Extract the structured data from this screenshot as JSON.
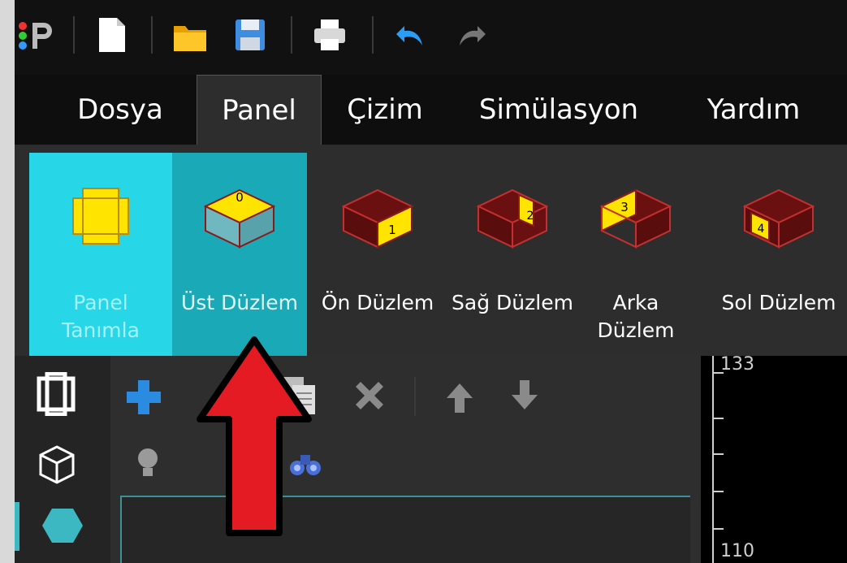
{
  "toolbar": {
    "icons": [
      "app-logo-icon",
      "new-file-icon",
      "open-folder-icon",
      "save-icon",
      "print-icon",
      "undo-icon",
      "redo-icon"
    ]
  },
  "menu": {
    "items": [
      {
        "label": "Dosya"
      },
      {
        "label": "Panel"
      },
      {
        "label": "Çizim"
      },
      {
        "label": "Simülasyon"
      },
      {
        "label": "Yardım"
      }
    ],
    "active": "Panel"
  },
  "ribbon": {
    "buttons": [
      {
        "label": "Panel Tanımla",
        "badge": ""
      },
      {
        "label": "Üst Düzlem",
        "badge": "0"
      },
      {
        "label": "Ön Düzlem",
        "badge": "1"
      },
      {
        "label": "Sağ Düzlem",
        "badge": "2"
      },
      {
        "label": "Arka Düzlem",
        "badge": "3"
      },
      {
        "label": "Sol Düzlem",
        "badge": "4"
      }
    ]
  },
  "ruler": {
    "top_label": "133",
    "bottom_label": "110"
  },
  "colors": {
    "accent": "#27d7e8",
    "accent_dark": "#1aa9b7",
    "arrow": "#e51b23",
    "face_yellow": "#ffea00",
    "box_red": "#8b1a1a"
  }
}
